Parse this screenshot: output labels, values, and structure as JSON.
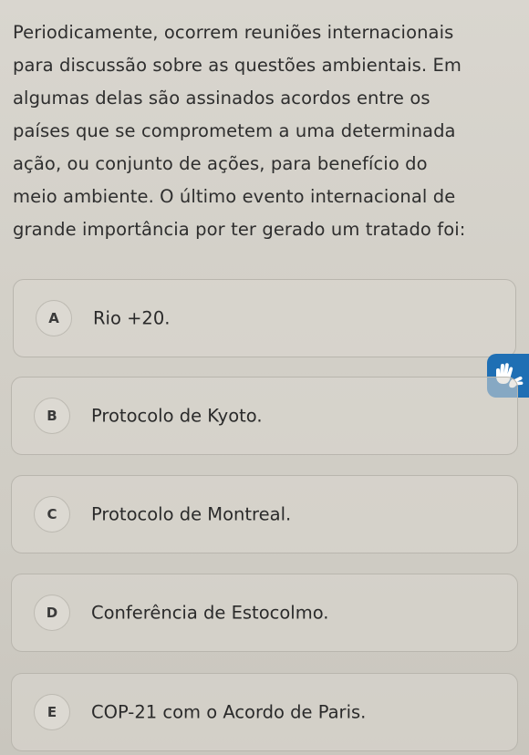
{
  "question": {
    "lines": [
      "Periodicamente, ocorrem reuniões internacionais",
      "para discussão sobre as questões ambientais. Em",
      "algumas delas são assinados acordos entre os",
      "países que se comprometem a uma determinada",
      "ação, ou conjunto de ações, para benefício do",
      "meio ambiente. O último evento internacional de",
      "grande importância por ter gerado um tratado foi:"
    ]
  },
  "options": [
    {
      "letter": "A",
      "text": "Rio +20."
    },
    {
      "letter": "B",
      "text": "Protocolo de Kyoto."
    },
    {
      "letter": "C",
      "text": "Protocolo de Montreal."
    },
    {
      "letter": "D",
      "text": "Conferência de Estocolmo."
    },
    {
      "letter": "E",
      "text": "COP-21 com o Acordo de Paris."
    }
  ],
  "accessibility": {
    "icon": "sign-language-hands-icon",
    "color": "#1f6fb4"
  }
}
